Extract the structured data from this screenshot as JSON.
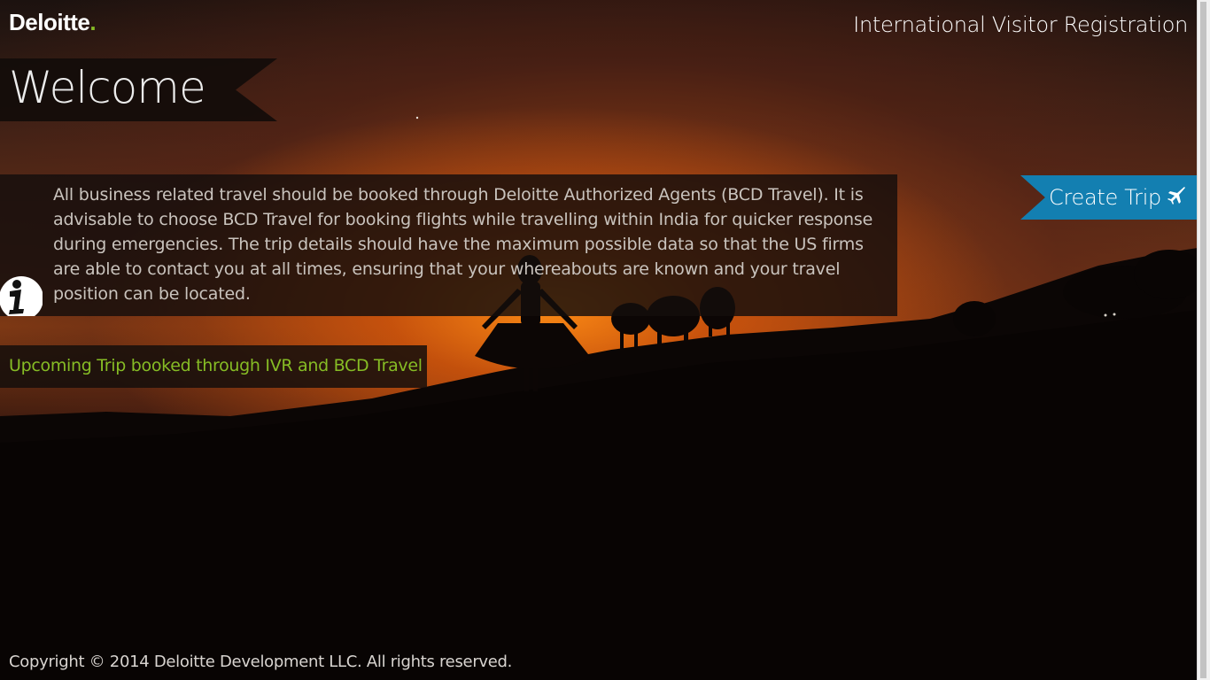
{
  "header": {
    "logo_text": "Deloitte",
    "logo_dot": ".",
    "app_title": "International Visitor Registration"
  },
  "welcome": {
    "title": "Welcome"
  },
  "info": {
    "icon": "info-icon",
    "text": "All business related travel should be booked through Deloitte Authorized Agents (BCD Travel). It is advisable to choose BCD Travel for booking flights while travelling within India for quicker response during emergencies. The trip details should have the maximum possible data so that the US firms are able to contact you at all times, ensuring that your whereabouts are known and your travel position can be located."
  },
  "actions": {
    "create_trip_label": "Create Trip",
    "create_trip_icon": "airplane-icon"
  },
  "upcoming": {
    "label": "Upcoming Trip booked through IVR and BCD Travel"
  },
  "footer": {
    "copyright": "Copyright © 2014 Deloitte Development LLC. All rights reserved."
  },
  "colors": {
    "brand_green": "#86bc25",
    "accent_blue": "#137fb1",
    "panel_dark": "#140e0c"
  }
}
